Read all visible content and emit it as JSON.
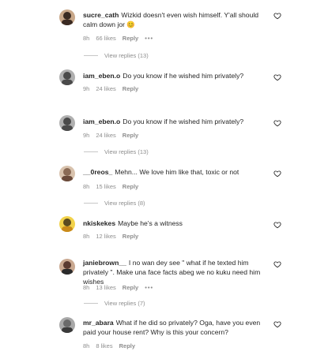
{
  "comments": [
    {
      "username": "sucre_cath",
      "text": "Wizkid doesn't even wish himself. Y'all should calm down jor 😊",
      "time": "8h",
      "likes": "66 likes",
      "reply": "Reply",
      "more": "•••",
      "view_replies": "View replies (13)",
      "avatar_color": "#3a2a22"
    },
    {
      "username": "iam_eben.o",
      "text": "Do you know if he wished him privately?",
      "time": "9h",
      "likes": "24 likes",
      "reply": "Reply",
      "avatar_color": "#4a4a4a"
    },
    {
      "username": "iam_eben.o",
      "text": "Do you know if he wished him privately?",
      "time": "9h",
      "likes": "24 likes",
      "reply": "Reply",
      "view_replies": "View replies (13)",
      "avatar_color": "#4a4a4a"
    },
    {
      "username": "__0reos_",
      "text": "Mehn... We love him like that, toxic or not",
      "time": "8h",
      "likes": "15 likes",
      "reply": "Reply",
      "view_replies": "View replies (8)",
      "avatar_color": "#8a6a55"
    },
    {
      "username": "nkiskekes",
      "text": "Maybe he's a witness",
      "time": "8h",
      "likes": "12 likes",
      "reply": "Reply",
      "avatar_color": "#d9b020"
    },
    {
      "username": "janiebrown__",
      "text": "I no wan dey see \" what if he texted him privately \". Make una face facts abeg we no kuku need him wishes",
      "time": "8h",
      "likes": "13 likes",
      "reply": "Reply",
      "more": "•••",
      "view_replies": "View replies (7)",
      "avatar_color": "#5a3a30"
    },
    {
      "username": "mr_abara",
      "text": "What if he did so privately? Oga, have you even paid your house rent? Why is this your concern?",
      "time": "8h",
      "likes": "8 likes",
      "reply": "Reply",
      "avatar_color": "#6a6a6a"
    }
  ],
  "icons": {
    "like": "heart-outline-icon"
  },
  "colors": {
    "text": "#262626",
    "muted": "#8e8e8e",
    "divider": "#c7c7c7"
  }
}
